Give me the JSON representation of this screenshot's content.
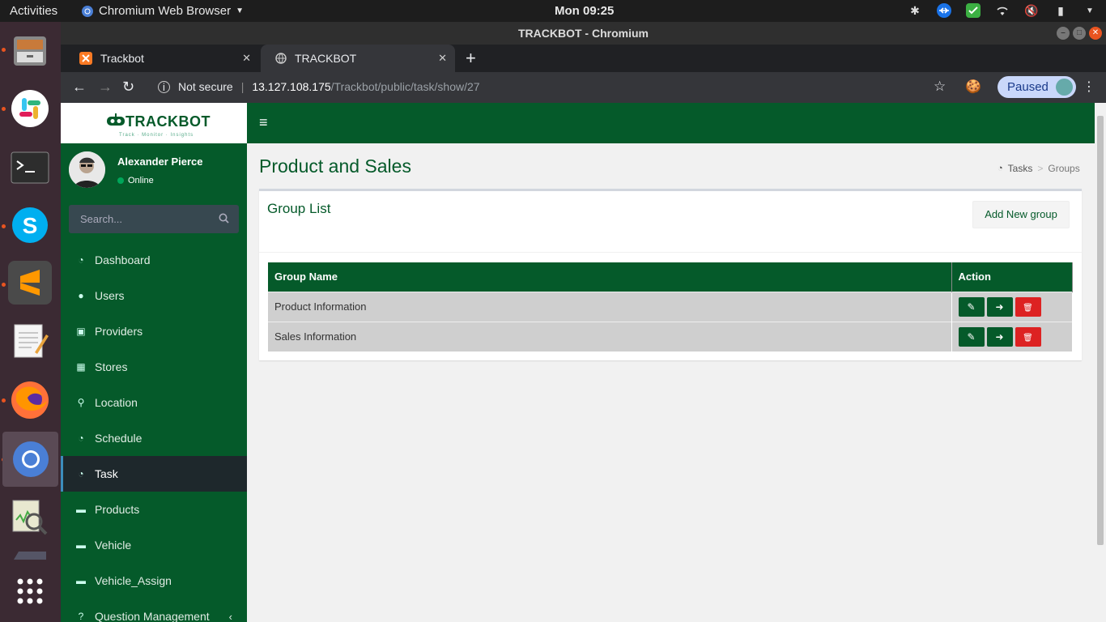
{
  "system": {
    "activities": "Activities",
    "app_menu": "Chromium Web Browser",
    "clock": "Mon 09:25"
  },
  "dock": {
    "apps": [
      "files",
      "slack",
      "terminal",
      "skype",
      "sublime-text",
      "text-editor",
      "firefox",
      "chromium",
      "system-monitor",
      "drive",
      "show-apps"
    ]
  },
  "window": {
    "title": "TRACKBOT - Chromium"
  },
  "tabs": [
    {
      "label": "Trackbot"
    },
    {
      "label": "TRACKBOT"
    }
  ],
  "address": {
    "security": "Not secure",
    "host": "13.127.108.175",
    "path": "/Trackbot/public/task/show/27",
    "paused": "Paused"
  },
  "sidebar": {
    "brand": "TRACKBOT",
    "tagline": "Track · Monitor · Insights",
    "user_name": "Alexander Pierce",
    "user_status": "Online",
    "search_placeholder": "Search...",
    "items": [
      {
        "label": "Dashboard",
        "icon": "dashboard-icon"
      },
      {
        "label": "Users",
        "icon": "user-icon"
      },
      {
        "label": "Providers",
        "icon": "lock-icon"
      },
      {
        "label": "Stores",
        "icon": "building-icon"
      },
      {
        "label": "Location",
        "icon": "map-marker-icon"
      },
      {
        "label": "Schedule",
        "icon": "dashboard-icon"
      },
      {
        "label": "Task",
        "icon": "dashboard-icon",
        "active": true
      },
      {
        "label": "Products",
        "icon": "car-icon"
      },
      {
        "label": "Vehicle",
        "icon": "car-icon"
      },
      {
        "label": "Vehicle_Assign",
        "icon": "car-icon"
      },
      {
        "label": "Question Management",
        "icon": "question-icon"
      }
    ]
  },
  "content": {
    "title": "Product and Sales",
    "breadcrumb": [
      "Tasks",
      "Groups"
    ],
    "box_title": "Group List",
    "add_button": "Add New group",
    "table": {
      "headers": [
        "Group Name",
        "Action"
      ],
      "rows": [
        {
          "name": "Product Information"
        },
        {
          "name": "Sales Information"
        }
      ]
    }
  },
  "colors": {
    "brand_green": "#055a2a",
    "delete_red": "#dd2222",
    "active_nav": "#1e282c"
  }
}
